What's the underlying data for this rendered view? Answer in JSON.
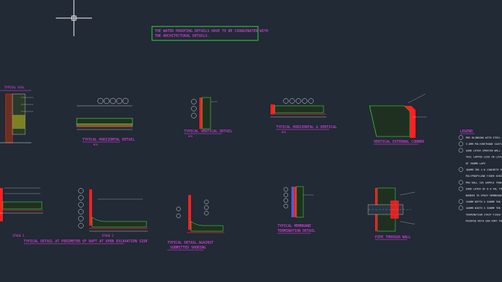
{
  "note": {
    "line1": "THE WATER PROOFING DETAILS HAVE TO BE COORDINATED WITH",
    "line2": "THE ARCHITECTURAL DETAILS."
  },
  "titles": {
    "typical_scale": "TYPICAL SCAL",
    "horizontal_detail": "TYPICAL HORIZONTAL DETAIL",
    "vertical_detail": "TYPICAL VERTICAL DETAIL",
    "horiz_vert": "TYPICAL HORIZONTAL & VERTICAL",
    "vertical_corner": "VERTICAL EXTERNAL CORNER",
    "legend": "LEGEND",
    "perimeter_detail": "TYPICAL DETAIL AT PERIMETER OF RAFT AT OPEN EXCAVATION SIDE",
    "against_shoring_1": "TYPICAL DETAIL AGAINST",
    "against_shoring_2": "SUBMITTED SHORING",
    "membrane_term_1": "TYPICAL MEMBRANE",
    "membrane_term_2": "TERMINATION DETAIL",
    "pipe_through": "PIPE THROUGH WALL",
    "stage1": "STAGE 1",
    "stage2": "STAGE 2"
  },
  "subtitles": {
    "horizontal": "NTS",
    "vertical": "NTS",
    "horiz_vert": "NTS"
  },
  "legend_items": [
    "PRE BLINDING WITH STEEL TOWE",
    "3.0MM POLYURETHANE COATING",
    "SAND LAYER SPRAYED WALL SPR",
    "TAIL LAPPED LAID IN LAYER OF",
    "OF 300MM LAPS",
    "100MM THK 1:6 CONCRETE MIX",
    "POLYPROPYLENE FIBER SHEET",
    "PRE WALL 10% SAMPLE TOWEL",
    "SAND LAYER OF 8-6 VAL THK F",
    "BONDED TO EPOXY MEMBRANE",
    "150MM DEPTH X 300MM THK PR",
    "100MM WIDTH X 300MM THK E",
    "TERMINATION STRIP FIXED WITH",
    "POINTED WITH SAN PART PU SEA"
  ],
  "crosshair": "cursor",
  "colors": {
    "background": "#212a35",
    "magenta": "#ff40ff",
    "white": "#e8e8e8",
    "green": "#40ff40",
    "red": "#ff2020",
    "cyan": "#40ffff",
    "blue": "#4060ff"
  }
}
